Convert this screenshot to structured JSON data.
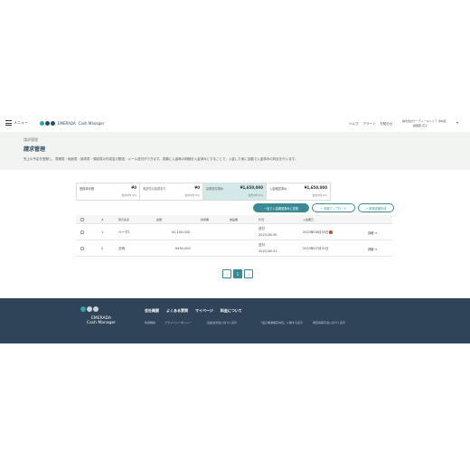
{
  "header": {
    "menu_label": "メニュー",
    "brand_name": "EMERADA",
    "brand_sub": "Cash Manager",
    "links": [
      "ヘルプ",
      "アラート",
      "お知らせ"
    ],
    "company_line1": "株式会社ケーディーキャリア 中村区",
    "company_line2": "経理部 花子"
  },
  "page": {
    "breadcrumb": "請求管理",
    "title": "請求管理",
    "description": "売上の予定を登録し、見積書・納品書・請求書・領収書の作成及び郵送・メール送付ができます。書類に入金時の明細を入金済みとすることで、入金した後に自動で入金済みの判定を行います。"
  },
  "tabs": [
    {
      "label": "登録済未確",
      "value": "¥0",
      "sub": "合計0件 0%"
    },
    {
      "label": "未送付の請求あり",
      "value": "¥0",
      "sub": "合計0件 0%"
    },
    {
      "label": "請求送付済み",
      "value": "¥1,650,000",
      "sub": "合計2件 0%"
    },
    {
      "label": "入金確認済み",
      "value": "¥1,650,000",
      "sub": "合計0件 0%"
    }
  ],
  "actions": {
    "primary": "一括で入金確認済みに変更",
    "upload": "+ 書類アップロード",
    "create": "+ 新規書類作成"
  },
  "table": {
    "headers": [
      "#",
      "取引先名",
      "金額",
      "請求書",
      "納品書",
      "状況",
      "入金期日"
    ],
    "rows": [
      {
        "num": "1",
        "client": "ペーダ1",
        "amount": "¥1,100,000",
        "status": "送付",
        "status_date": "2023-06-30",
        "due": "2023年06月30日",
        "detail": "詳細 ➜"
      },
      {
        "num": "2",
        "client": "文明",
        "amount": "¥450,000",
        "status": "送付",
        "status_date": "2023-06-31",
        "due": "2023年07月31日",
        "detail": "詳細 ➜"
      }
    ]
  },
  "pager": {
    "prev": "‹",
    "current": "1",
    "next": "›"
  },
  "footer": {
    "brand_line1": "EMERADA",
    "brand_line2": "Cash Manager",
    "nav": [
      "会社概要",
      "よくある質問",
      "マイページ",
      "料金について"
    ],
    "sub": [
      "利用規約",
      "プライバシーポリシー",
      "資金決済法に基づく表示",
      "「電子帳簿保存対応」に関する表示",
      "特定商取引法に基づく表示"
    ]
  },
  "colors": {
    "accent": "#3a8a96",
    "footer_bg": "#2f4459",
    "brand": "#2f4c62",
    "alert": "#d0443c"
  }
}
